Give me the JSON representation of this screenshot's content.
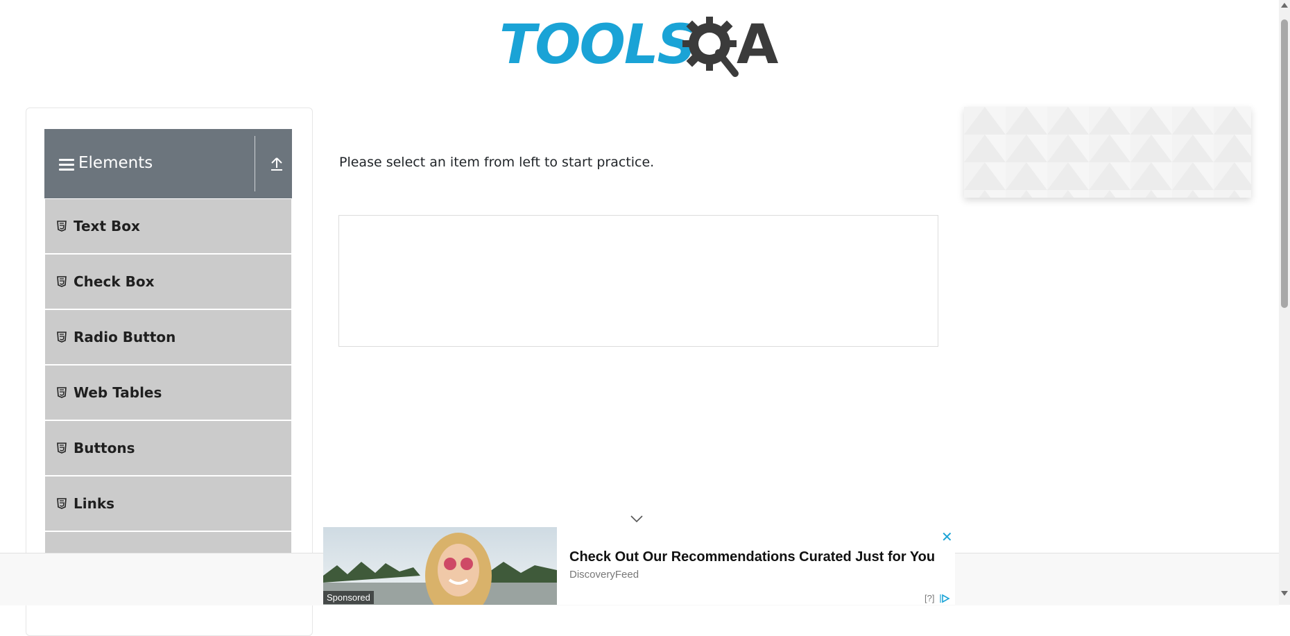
{
  "logo": {
    "part1": "TOOLS",
    "part2": "A",
    "colors": {
      "primary": "#1aa3d6",
      "dark": "#3b3b3b"
    }
  },
  "sidebar": {
    "group_title": "Elements",
    "header_color": "#6c757d",
    "items": [
      {
        "label": "Text Box",
        "icon": "html5-icon"
      },
      {
        "label": "Check Box",
        "icon": "html5-icon"
      },
      {
        "label": "Radio Button",
        "icon": "html5-icon"
      },
      {
        "label": "Web Tables",
        "icon": "html5-icon"
      },
      {
        "label": "Buttons",
        "icon": "html5-icon"
      },
      {
        "label": "Links",
        "icon": "html5-icon"
      },
      {
        "label": "",
        "icon": "html5-icon"
      }
    ]
  },
  "main": {
    "prompt": "Please select an item from left to start practice."
  },
  "ad": {
    "sponsored": "Sponsored",
    "headline": "Check Out Our Recommendations Curated Just for You",
    "source": "DiscoveryFeed",
    "help": "[?]"
  }
}
